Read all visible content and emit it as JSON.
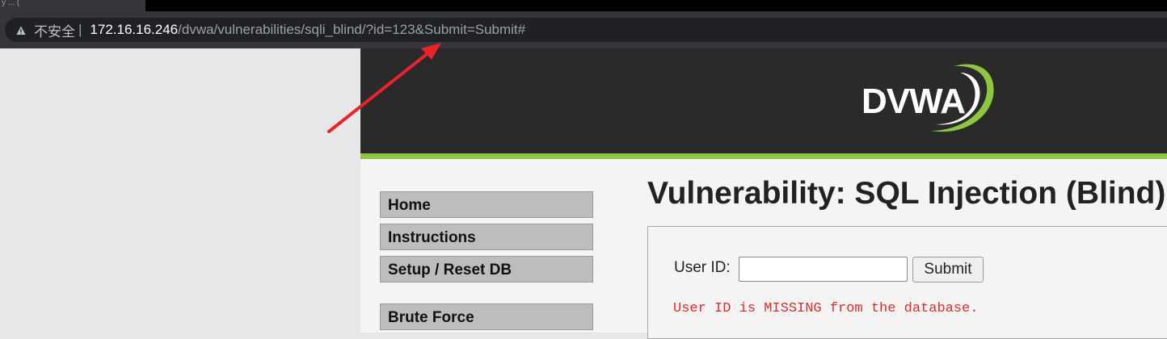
{
  "browser": {
    "tab_fragment": "y  ...  (",
    "security_label": "不安全",
    "divider": "|",
    "url_host": "172.16.16.246",
    "url_path": "/dvwa/vulnerabilities/sqli_blind/?id=123&Submit=Submit#"
  },
  "header": {
    "logo_text": "DVWA"
  },
  "menu": {
    "items": [
      {
        "label": "Home"
      },
      {
        "label": "Instructions"
      },
      {
        "label": "Setup / Reset DB"
      },
      {
        "label": "Brute Force"
      }
    ]
  },
  "main": {
    "title": "Vulnerability: SQL Injection (Blind)",
    "user_id_label": "User ID:",
    "user_id_value": "",
    "submit_label": "Submit",
    "result_message": "User ID is MISSING from the database."
  },
  "colors": {
    "accent_green": "#8dc63f",
    "header_bg": "#2a2a2a",
    "error_red": "#e12b2b",
    "annotation_arrow": "#e8232b"
  }
}
